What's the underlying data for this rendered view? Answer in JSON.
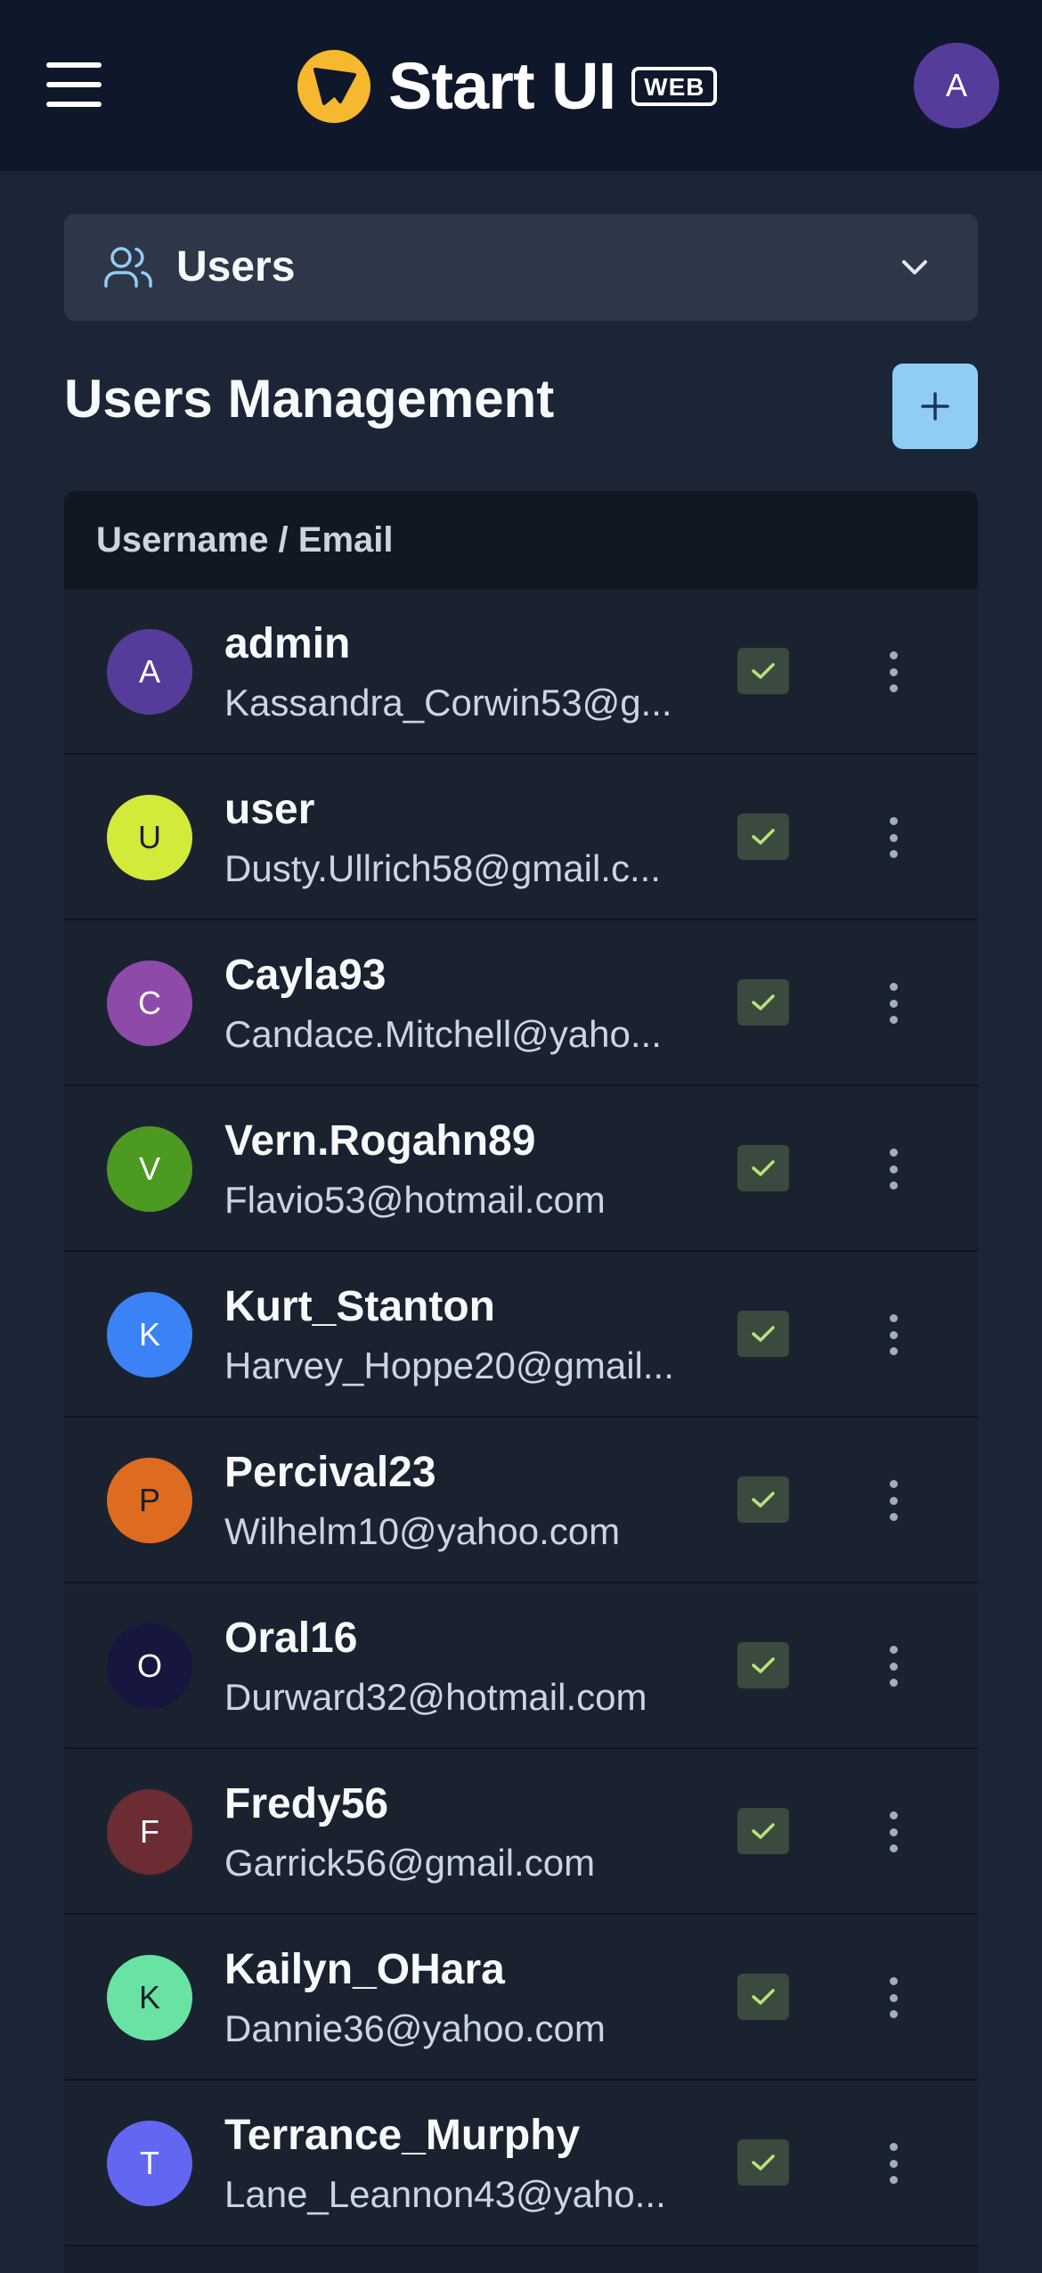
{
  "header": {
    "app_name": "Start UI",
    "badge": "WEB",
    "user_initial": "A",
    "avatar_color": "#553c9a"
  },
  "section_selector": {
    "label": "Users",
    "icon": "users-icon"
  },
  "page": {
    "title": "Users Management",
    "add_icon": "plus-icon"
  },
  "table": {
    "column_header": "Username / Email",
    "rows": [
      {
        "initial": "A",
        "username": "admin",
        "email": "Kassandra_Corwin53@g...",
        "avatar_bg": "#553c9a",
        "avatar_fg": "#ffffff",
        "activated": true
      },
      {
        "initial": "U",
        "username": "user",
        "email": "Dusty.Ullrich58@gmail.c...",
        "avatar_bg": "#d4ea3a",
        "avatar_fg": "#1a202c",
        "activated": true
      },
      {
        "initial": "C",
        "username": "Cayla93",
        "email": "Candace.Mitchell@yaho...",
        "avatar_bg": "#8e4aa8",
        "avatar_fg": "#ffffff",
        "activated": true
      },
      {
        "initial": "V",
        "username": "Vern.Rogahn89",
        "email": "Flavio53@hotmail.com",
        "avatar_bg": "#4d9a22",
        "avatar_fg": "#ffffff",
        "activated": true
      },
      {
        "initial": "K",
        "username": "Kurt_Stanton",
        "email": "Harvey_Hoppe20@gmail...",
        "avatar_bg": "#3b82f6",
        "avatar_fg": "#ffffff",
        "activated": true
      },
      {
        "initial": "P",
        "username": "Percival23",
        "email": "Wilhelm10@yahoo.com",
        "avatar_bg": "#dd6b20",
        "avatar_fg": "#1a202c",
        "activated": true
      },
      {
        "initial": "O",
        "username": "Oral16",
        "email": "Durward32@hotmail.com",
        "avatar_bg": "#16163f",
        "avatar_fg": "#ffffff",
        "activated": true
      },
      {
        "initial": "F",
        "username": "Fredy56",
        "email": "Garrick56@gmail.com",
        "avatar_bg": "#6b2c34",
        "avatar_fg": "#ffffff",
        "activated": true
      },
      {
        "initial": "K",
        "username": "Kailyn_OHara",
        "email": "Dannie36@yahoo.com",
        "avatar_bg": "#68e3a4",
        "avatar_fg": "#1a202c",
        "activated": true
      },
      {
        "initial": "T",
        "username": "Terrance_Murphy",
        "email": "Lane_Leannon43@yaho...",
        "avatar_bg": "#6366f1",
        "avatar_fg": "#ffffff",
        "activated": true
      }
    ]
  },
  "colors": {
    "background": "#1c2535",
    "topbar": "#0f172a",
    "accent": "#90cdf4",
    "check": "#b7e27a"
  }
}
